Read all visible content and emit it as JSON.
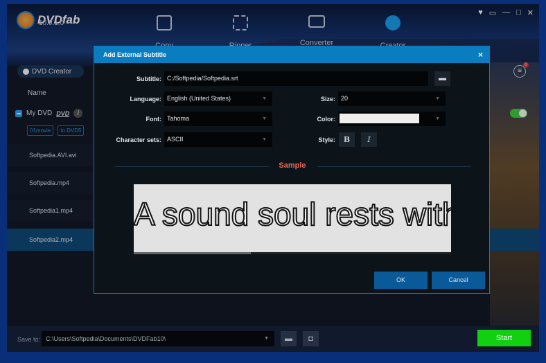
{
  "app": {
    "name": "DVDfab",
    "version": "10.0.1.0"
  },
  "nav": [
    {
      "label": "Copy"
    },
    {
      "label": "Ripper"
    },
    {
      "label": "Converter"
    },
    {
      "label": "Creator"
    }
  ],
  "window_controls": [
    "shirt-icon",
    "monitor-icon",
    "minimize-icon",
    "maximize-icon",
    "close-icon"
  ],
  "left": {
    "mode_button": "DVD Creator",
    "column_name": "Name",
    "disc": {
      "label": "My DVD",
      "format": "DVD",
      "tags": [
        "01movie",
        "to DVD5"
      ]
    },
    "files": [
      "Softpedia.AVI.avi",
      "Softpedia.mp4",
      "Softpedia1.mp4",
      "Softpedia2.mp4"
    ],
    "selected_index": 3
  },
  "menu_badge": "0",
  "toggle_on": true,
  "bottom": {
    "save_to_label": "Save to:",
    "save_path": "C:\\Users\\Softpedia\\Documents\\DVDFab10\\",
    "start_label": "Start"
  },
  "dialog": {
    "title": "Add External Subtitle",
    "close": "×",
    "subtitle_label": "Subtitle:",
    "subtitle_value": "C:/Softpedia/Softpedia.srt",
    "language_label": "Language:",
    "language_value": "English (United States)",
    "font_label": "Font:",
    "font_value": "Tahoma",
    "charset_label": "Character sets:",
    "charset_value": "ASCII",
    "size_label": "Size:",
    "size_value": "20",
    "color_label": "Color:",
    "color_value": "#eeeeee",
    "style_label": "Style:",
    "bold": "B",
    "italic": "I",
    "sample_label": "Sample",
    "sample_text": "A sound soul rests with",
    "ok": "OK",
    "cancel": "Cancel"
  },
  "colors": {
    "accent": "#0a7cc0",
    "start": "#10d010",
    "sample_label": "#e86a5a"
  }
}
